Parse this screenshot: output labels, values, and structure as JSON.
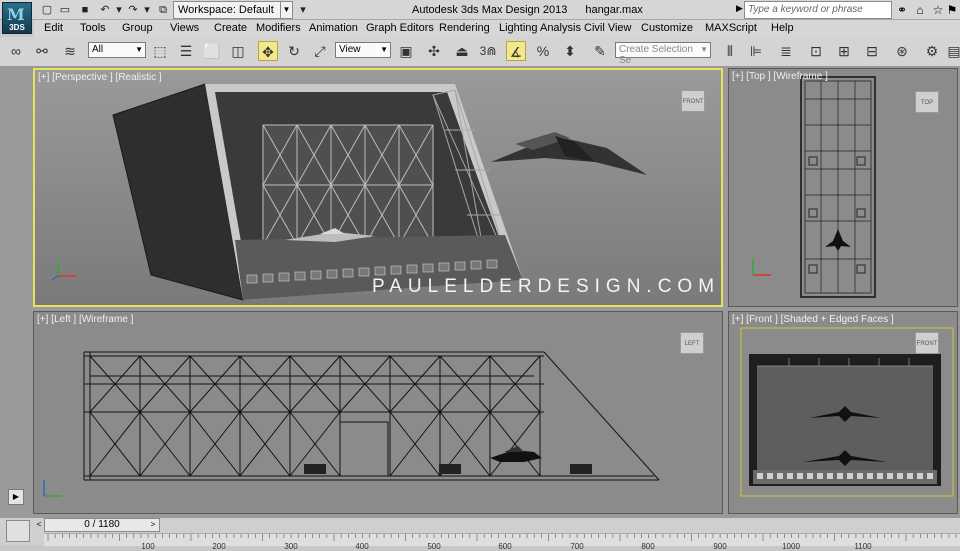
{
  "titlebar": {
    "app_logo": "3DS",
    "workspace_label": "Workspace: Default",
    "window_title": "Autodesk 3ds Max Design 2013",
    "file_name": "hangar.max",
    "search_placeholder": "Type a keyword or phrase"
  },
  "menu": [
    "Edit",
    "Tools",
    "Group",
    "Views",
    "Create",
    "Modifiers",
    "Animation",
    "Graph Editors",
    "Rendering",
    "Lighting Analysis",
    "Civil View",
    "Customize",
    "MAXScript",
    "Help"
  ],
  "toolbar": {
    "selection_filter": "All",
    "ref_coord": "View",
    "snap_value": "3",
    "named_selection_placeholder": "Create Selection Se"
  },
  "viewports": {
    "perspective": {
      "label": "[+] [Perspective ] [Realistic ]",
      "viewcube": "FRONT",
      "watermark": "PAULELDERDESIGN.COM"
    },
    "top": {
      "label": "[+] [Top ] [Wireframe ]",
      "viewcube": "TOP"
    },
    "left": {
      "label": "[+] [Left ] [Wireframe ]",
      "viewcube": "LEFT"
    },
    "front": {
      "label": "[+] [Front ] [Shaded + Edged Faces ]",
      "viewcube": "FRONT"
    }
  },
  "timeline": {
    "frame": "0 / 1180",
    "ticks": [
      "100",
      "200",
      "300",
      "400",
      "500",
      "600",
      "700",
      "800",
      "900",
      "1000",
      "1100"
    ]
  },
  "colors": {
    "viewport_bg": "#8b8b8b",
    "active_border": "#e6e35a",
    "ui_bg": "#d6d6d6"
  }
}
